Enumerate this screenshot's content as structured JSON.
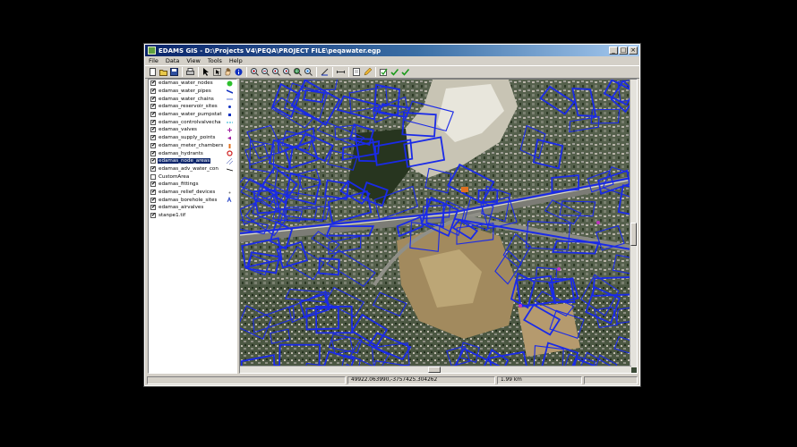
{
  "window": {
    "title": "EDAMS GIS - D:\\Projects V4\\PEQA\\PROJECT FILE\\peqawater.egp",
    "buttons": {
      "minimize": "_",
      "maximize": "□",
      "close": "×"
    }
  },
  "menu": [
    "File",
    "Data",
    "View",
    "Tools",
    "Help"
  ],
  "toolbar": [
    "new-icon",
    "open-icon",
    "save-icon",
    "sep",
    "print-icon",
    "sep",
    "pointer-icon",
    "select-icon",
    "pan-icon",
    "info-icon",
    "sep",
    "zoom-in-icon",
    "zoom-out-icon",
    "zoom-prev-icon",
    "zoom-next-icon",
    "zoom-extent-icon",
    "zoom-layer-icon",
    "sep",
    "measure-icon",
    "sep",
    "ruler-icon",
    "sep",
    "edit-icon",
    "pencil-icon",
    "sep",
    "check-icon",
    "check-icon",
    "check-icon"
  ],
  "layers": [
    {
      "label": "edamas_water_nodes",
      "checked": true,
      "symbol": "green-dot"
    },
    {
      "label": "edamas_water_pipes",
      "checked": true,
      "symbol": "blue-line"
    },
    {
      "label": "edamas_water_chains",
      "checked": true,
      "symbol": "blue-thin"
    },
    {
      "label": "edamas_reservoir_sites",
      "checked": true,
      "symbol": "blue-pin"
    },
    {
      "label": "edamas_water_pumpstat",
      "checked": true,
      "symbol": "blue-square"
    },
    {
      "label": "edamas_controlvalvecha",
      "checked": true,
      "symbol": "cyan-dash"
    },
    {
      "label": "edamas_valves",
      "checked": true,
      "symbol": "purple-mark"
    },
    {
      "label": "edamas_supply_points",
      "checked": true,
      "symbol": "purple-arrow"
    },
    {
      "label": "edamas_meter_chambers",
      "checked": true,
      "symbol": "orange-mark"
    },
    {
      "label": "edamas_hydrants",
      "checked": true,
      "symbol": "red-ring"
    },
    {
      "label": "edamas_node_areas",
      "checked": true,
      "symbol": "hatch",
      "selected": true
    },
    {
      "label": "edamas_adv_water_con",
      "checked": true,
      "symbol": "black-line"
    },
    {
      "label": "CustomArea",
      "checked": false,
      "symbol": ""
    },
    {
      "label": "edamas_fittings",
      "checked": true,
      "symbol": ""
    },
    {
      "label": "edamas_relief_devices",
      "checked": true,
      "symbol": "grey-dot"
    },
    {
      "label": "edamas_borehole_sites",
      "checked": true,
      "symbol": "blue-glyph"
    },
    {
      "label": "edamas_airvalves",
      "checked": true,
      "symbol": ""
    },
    {
      "label": "stanpe1.tif",
      "checked": true,
      "symbol": ""
    }
  ],
  "status": {
    "left": "",
    "coordinates": "49922.063990,-3757425.304262",
    "scale": "1.99 km",
    "right": ""
  },
  "colors": {
    "pipes": "#1020e0",
    "title_start": "#0a246a",
    "selected": "#0a246a"
  }
}
